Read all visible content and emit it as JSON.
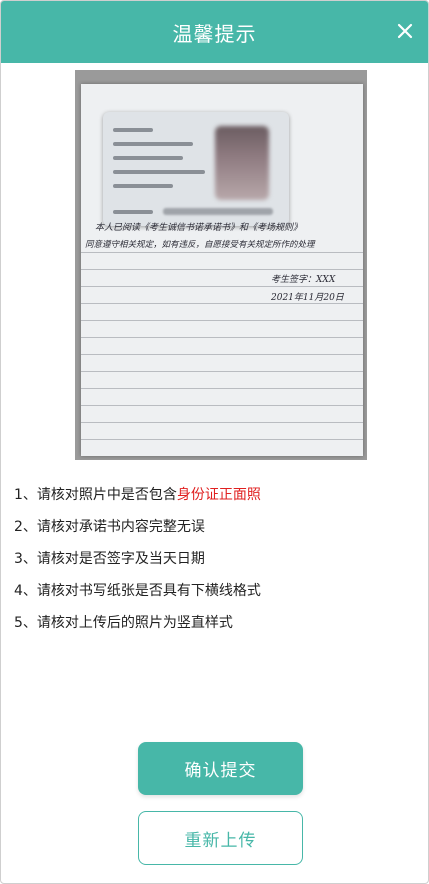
{
  "header": {
    "title": "温馨提示",
    "close_icon": "close-icon"
  },
  "photo": {
    "statement_line1": "本人已阅读《考生诚信书诺承诺书》和《考场规则》",
    "statement_line2": "同意遵守相关规定，如有违反，自愿接受有关规定所作的处理",
    "signature": "考生签字：XXX",
    "date": "2021年11月20日"
  },
  "tips": [
    {
      "prefix": "1、请核对照片中是否包含",
      "highlight": "身份证正面照"
    },
    {
      "prefix": "2、请核对承诺书内容完整无误",
      "highlight": ""
    },
    {
      "prefix": "3、请核对是否签字及当天日期",
      "highlight": ""
    },
    {
      "prefix": "4、请核对书写纸张是否具有下横线格式",
      "highlight": ""
    },
    {
      "prefix": "5、请核对上传后的照片为竖直样式",
      "highlight": ""
    }
  ],
  "buttons": {
    "confirm": "确认提交",
    "reupload": "重新上传"
  },
  "colors": {
    "accent": "#47b7a8",
    "highlight": "#e02020"
  }
}
